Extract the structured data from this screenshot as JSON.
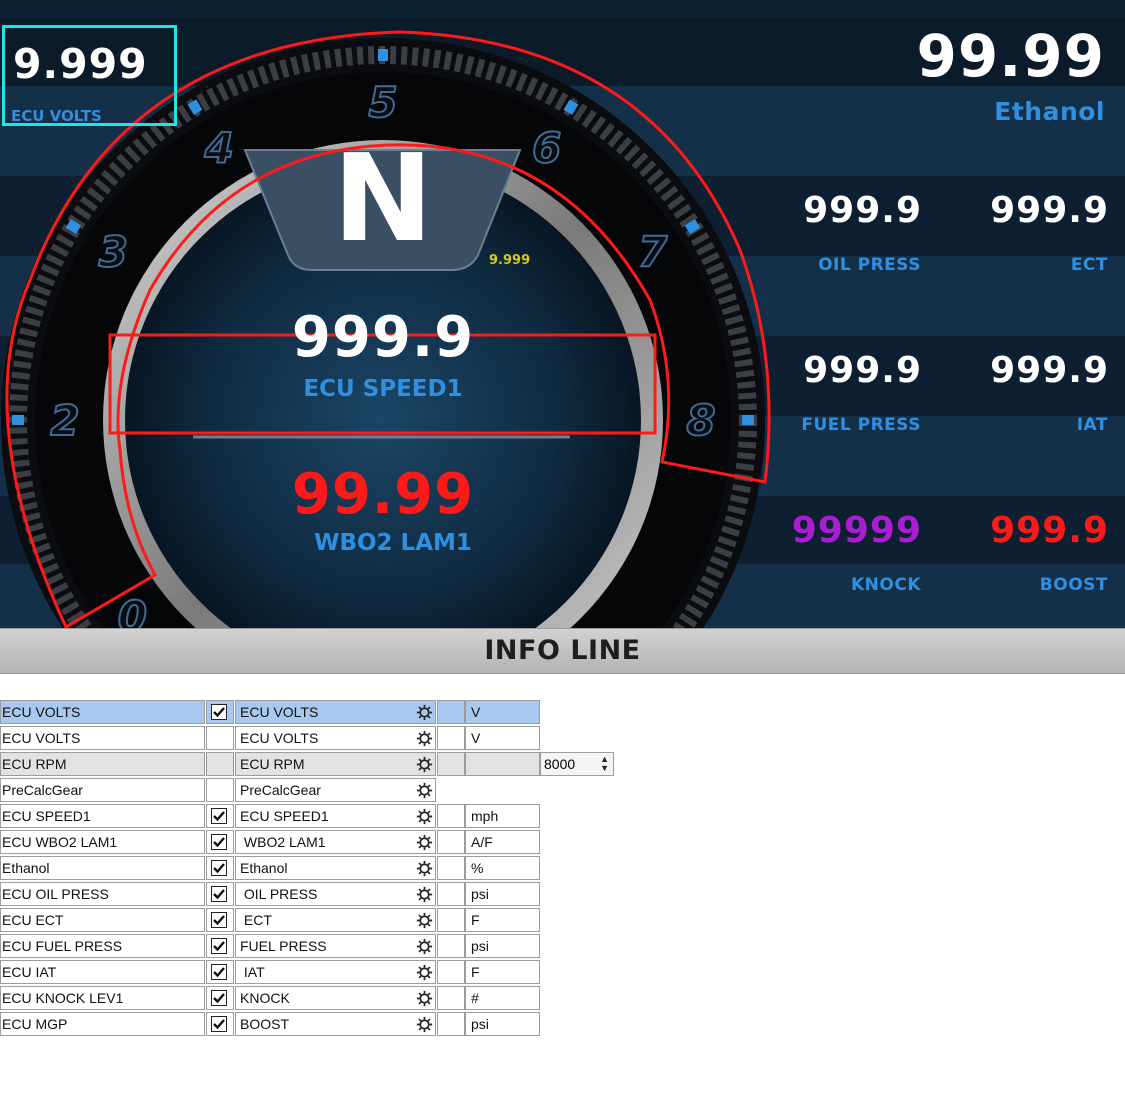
{
  "dashboard": {
    "gear": "N",
    "volts_box": {
      "value": "9.999",
      "label": "ECU VOLTS"
    },
    "small_readout": "9.999",
    "center_top": {
      "value": "999.9",
      "label": "ECU SPEED1"
    },
    "center_bottom": {
      "value": "99.99",
      "label": "WBO2 LAM1"
    },
    "rpm_ticks": [
      "0",
      "2",
      "3",
      "4",
      "5",
      "6",
      "7",
      "8"
    ],
    "right_top": {
      "value": "99.99",
      "label": "Ethanol"
    },
    "right_gauges": [
      {
        "value": "999.9",
        "label": "OIL PRESS"
      },
      {
        "value": "999.9",
        "label": "ECT"
      },
      {
        "value": "999.9",
        "label": "FUEL PRESS"
      },
      {
        "value": "999.9",
        "label": "IAT"
      },
      {
        "value": "99999",
        "label": "KNOCK"
      },
      {
        "value": "999.9",
        "label": "BOOST"
      }
    ],
    "colors": {
      "label_blue": "#2f8fe0",
      "alert_red": "#ff1a1a",
      "knock_purple": "#a81ed0",
      "highlight_cyan": "#1ee6e6",
      "small_yellow": "#d8c81e"
    }
  },
  "info_line": {
    "title": "INFO LINE"
  },
  "table": {
    "rows": [
      {
        "source": "ECU VOLTS",
        "checked": true,
        "display": "ECU VOLTS",
        "unit": "V"
      },
      {
        "source": "ECU VOLTS",
        "checked": false,
        "display": "ECU VOLTS",
        "unit": "V"
      },
      {
        "source": "ECU RPM",
        "checked": false,
        "display": "ECU RPM",
        "unit": "",
        "select": "8000"
      },
      {
        "source": "PreCalcGear",
        "checked": false,
        "display": "PreCalcGear"
      },
      {
        "source": "ECU SPEED1",
        "checked": true,
        "display": "ECU SPEED1",
        "unit": "mph"
      },
      {
        "source": "ECU WBO2 LAM1",
        "checked": true,
        "display": " WBO2 LAM1",
        "unit": "A/F"
      },
      {
        "source": "Ethanol",
        "checked": true,
        "display": "Ethanol",
        "unit": "%"
      },
      {
        "source": "ECU OIL PRESS",
        "checked": true,
        "display": " OIL PRESS",
        "unit": "psi"
      },
      {
        "source": "ECU ECT",
        "checked": true,
        "display": " ECT",
        "unit": "F"
      },
      {
        "source": "ECU FUEL PRESS",
        "checked": true,
        "display": "FUEL PRESS",
        "unit": "psi"
      },
      {
        "source": "ECU IAT",
        "checked": true,
        "display": " IAT",
        "unit": "F"
      },
      {
        "source": "ECU KNOCK LEV1",
        "checked": true,
        "display": "KNOCK",
        "unit": "#"
      },
      {
        "source": "ECU MGP",
        "checked": true,
        "display": "BOOST",
        "unit": "psi"
      }
    ]
  }
}
